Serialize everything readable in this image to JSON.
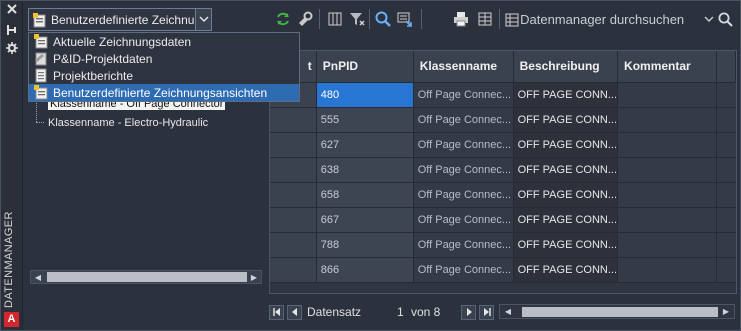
{
  "side_strip": {
    "title": "DATENMANAGER",
    "buttons": [
      "close-icon",
      "pin-icon",
      "settings-icon"
    ],
    "logo": "A"
  },
  "view_select": {
    "value": "Benutzerdefinierte Zeichnungsansichten",
    "icon": "custom-view-icon"
  },
  "dropdown": {
    "options": [
      {
        "label": "Aktuelle Zeichnungsdaten",
        "icon": "current-drawing-icon"
      },
      {
        "label": "P&ID-Projektdaten",
        "icon": "project-data-icon"
      },
      {
        "label": "Projektberichte",
        "icon": "report-icon"
      },
      {
        "label": "Benutzerdefinierte Zeichnungsansichten",
        "icon": "custom-view-icon",
        "selected": true
      }
    ]
  },
  "tree": {
    "items": [
      {
        "label": "Klassenname - Off Page Connector",
        "selected": true
      },
      {
        "label": "Klassenname - Electro-Hydraulic",
        "selected": false
      }
    ]
  },
  "toolbar": {
    "buttons": [
      "refresh-icon",
      "link-icon",
      "columns-icon",
      "filter-icon",
      "zoom-icon",
      "export-icon",
      "print-icon",
      "grid-icon"
    ],
    "search_placeholder": "Datenmanager durchsuchen"
  },
  "grid": {
    "columns": [
      "t",
      "PnPID",
      "Klassenname",
      "Beschreibung",
      "Kommentar"
    ],
    "rows": [
      {
        "pnpid": "480",
        "klasse": "Off Page Connec...",
        "beschr": "OFF PAGE CONN...",
        "komm": ""
      },
      {
        "pnpid": "555",
        "klasse": "Off Page Connec...",
        "beschr": "OFF PAGE CONN...",
        "komm": ""
      },
      {
        "pnpid": "627",
        "klasse": "Off Page Connec...",
        "beschr": "OFF PAGE CONN...",
        "komm": ""
      },
      {
        "pnpid": "638",
        "klasse": "Off Page Connec...",
        "beschr": "OFF PAGE CONN...",
        "komm": ""
      },
      {
        "pnpid": "658",
        "klasse": "Off Page Connec...",
        "beschr": "OFF PAGE CONN...",
        "komm": ""
      },
      {
        "pnpid": "667",
        "klasse": "Off Page Connec...",
        "beschr": "OFF PAGE CONN...",
        "komm": ""
      },
      {
        "pnpid": "788",
        "klasse": "Off Page Connec...",
        "beschr": "OFF PAGE CONN...",
        "komm": ""
      },
      {
        "pnpid": "866",
        "klasse": "Off Page Connec...",
        "beschr": "OFF PAGE CONN...",
        "komm": ""
      }
    ],
    "selected_row": 0
  },
  "navigator": {
    "label": "Datensatz",
    "current": "1",
    "of_label": "von 8"
  },
  "colors": {
    "background": "#2b313d",
    "selection": "#2876d4",
    "dropdown_selection": "#2d6bb3",
    "app_logo": "#d4272c"
  }
}
